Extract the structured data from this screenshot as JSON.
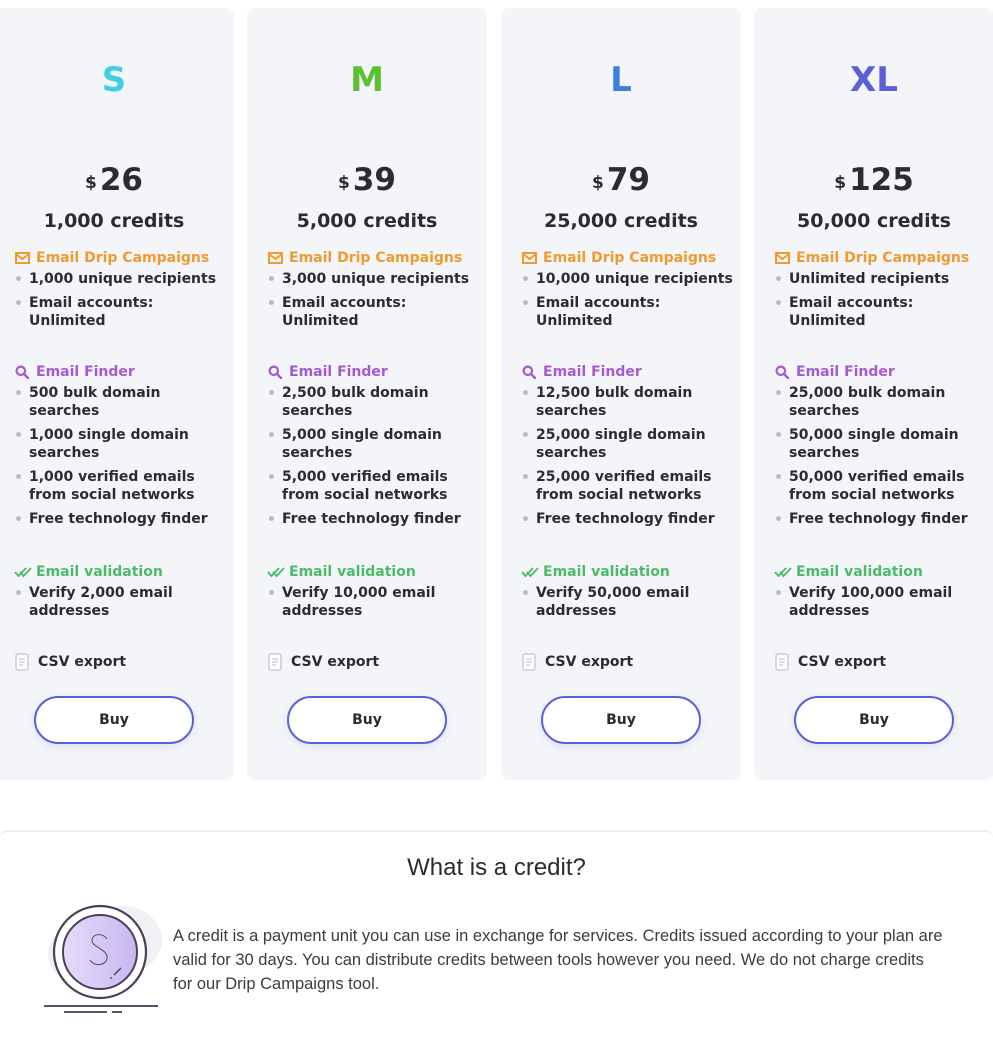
{
  "plans": [
    {
      "name": "S",
      "name_color": "#3dcfe8",
      "currency": "$",
      "price": "26",
      "credits": "1,000 credits",
      "drip_title": "Email Drip Campaigns",
      "drip_items": [
        "1,000 unique recipients",
        "Email accounts: Unlimited"
      ],
      "finder_title": "Email Finder",
      "finder_items": [
        "500 bulk domain searches",
        "1,000 single domain searches",
        "1,000 verified emails from social networks",
        "Free technology finder"
      ],
      "validation_title": "Email validation",
      "validation_items": [
        "Verify 2,000 email addresses"
      ],
      "csv_label": "CSV export",
      "buy_label": "Buy"
    },
    {
      "name": "M",
      "name_color": "#5cc132",
      "currency": "$",
      "price": "39",
      "credits": "5,000 credits",
      "drip_title": "Email Drip Campaigns",
      "drip_items": [
        "3,000 unique recipients",
        "Email accounts: Unlimited"
      ],
      "finder_title": "Email Finder",
      "finder_items": [
        "2,500 bulk domain searches",
        "5,000 single domain searches",
        "5,000 verified emails from social networks",
        "Free technology finder"
      ],
      "validation_title": "Email validation",
      "validation_items": [
        "Verify 10,000 email addresses"
      ],
      "csv_label": "CSV export",
      "buy_label": "Buy"
    },
    {
      "name": "L",
      "name_color": "#3f7de0",
      "currency": "$",
      "price": "79",
      "credits": "25,000 credits",
      "drip_title": "Email Drip Campaigns",
      "drip_items": [
        "10,000 unique recipients",
        "Email accounts: Unlimited"
      ],
      "finder_title": "Email Finder",
      "finder_items": [
        "12,500 bulk domain searches",
        "25,000 single domain searches",
        "25,000 verified emails from social networks",
        "Free technology finder"
      ],
      "validation_title": "Email validation",
      "validation_items": [
        "Verify 50,000 email addresses"
      ],
      "csv_label": "CSV export",
      "buy_label": "Buy"
    },
    {
      "name": "XL",
      "name_color": "#5b5fd6",
      "currency": "$",
      "price": "125",
      "credits": "50,000 credits",
      "drip_title": "Email Drip Campaigns",
      "drip_items": [
        "Unlimited recipients",
        "Email accounts: Unlimited"
      ],
      "finder_title": "Email Finder",
      "finder_items": [
        "25,000 bulk domain searches",
        "50,000 single domain searches",
        "50,000 verified emails from social networks",
        "Free technology finder"
      ],
      "validation_title": "Email validation",
      "validation_items": [
        "Verify 100,000 email addresses"
      ],
      "csv_label": "CSV export",
      "buy_label": "Buy"
    }
  ],
  "colors": {
    "drip": "#f29a2e",
    "finder": "#a55ad0",
    "validation": "#4cbb68",
    "button_border": "#5b63d9"
  },
  "icons": {
    "drip": "envelope-icon",
    "finder": "search-icon",
    "validation": "double-check-icon",
    "csv": "document-icon",
    "credit": "coin-icon"
  },
  "credit_info": {
    "title": "What is a credit?",
    "text": "A credit is a payment unit you can use in exchange for services. Credits issued according to your plan are valid for 30 days. You can distribute credits between tools however you need. We do not charge credits for our Drip Campaigns tool."
  }
}
